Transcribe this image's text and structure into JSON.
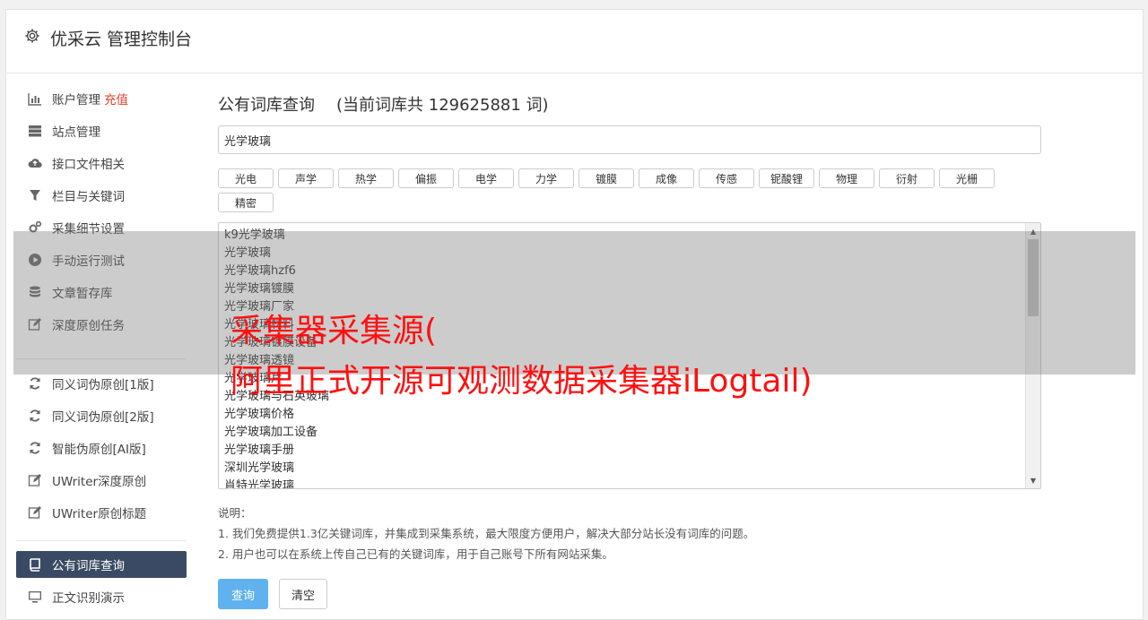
{
  "header": {
    "title": "优采云 管理控制台"
  },
  "sidebar": {
    "items": [
      {
        "label": "账户管理",
        "icon": "bar-chart-icon",
        "badge": "充值"
      },
      {
        "label": "站点管理",
        "icon": "server-icon"
      },
      {
        "label": "接口文件相关",
        "icon": "cloud-upload-icon"
      },
      {
        "label": "栏目与关键词",
        "icon": "filter-icon"
      },
      {
        "label": "采集细节设置",
        "icon": "gears-icon"
      },
      {
        "label": "手动运行测试",
        "icon": "play-circle-icon"
      },
      {
        "label": "文章暂存库",
        "icon": "database-icon"
      },
      {
        "label": "深度原创任务",
        "icon": "edit-icon"
      },
      {
        "label": "同义词伪原创[1版]",
        "icon": "refresh-icon"
      },
      {
        "label": "同义词伪原创[2版]",
        "icon": "refresh-icon"
      },
      {
        "label": "智能伪原创[AI版]",
        "icon": "refresh-icon"
      },
      {
        "label": "UWriter深度原创",
        "icon": "edit-icon"
      },
      {
        "label": "UWriter原创标题",
        "icon": "edit-icon"
      },
      {
        "label": "公有词库查询",
        "icon": "book-icon"
      },
      {
        "label": "正文识别演示",
        "icon": "monitor-icon"
      }
    ]
  },
  "content": {
    "title": "公有词库查询",
    "count_text": "(当前词库共 129625881 词)",
    "search_value": "光学玻璃",
    "tags": [
      "光电",
      "声学",
      "热学",
      "偏振",
      "电学",
      "力学",
      "镀膜",
      "成像",
      "传感",
      "铌酸锂",
      "物理",
      "衍射",
      "光栅",
      "精密"
    ],
    "results": [
      "k9光学玻璃",
      "光学玻璃",
      "光学玻璃hzf6",
      "光学玻璃镀膜",
      "光学玻璃厂家",
      "光学玻璃材料",
      "光学玻璃镀膜设备",
      "光学玻璃透镜",
      "光学玻璃片",
      "光学玻璃与石英玻璃",
      "光学玻璃价格",
      "光学玻璃加工设备",
      "光学玻璃手册",
      "深圳光学玻璃",
      "肖特光学玻璃"
    ],
    "notes": {
      "heading": "说明：",
      "lines": [
        "1. 我们免费提供1.3亿关键词库，并集成到采集系统，最大限度方便用户，解决大部分站长没有词库的问题。",
        "2. 用户也可以在系统上传自己已有的关键词库，用于自己账号下所有网站采集。"
      ]
    },
    "buttons": {
      "query": "查询",
      "clear": "清空"
    }
  },
  "overlay": {
    "line1": "采集器采集源(",
    "line2": "阿里正式开源可观测数据采集器iLogtail)"
  },
  "colors": {
    "accent": "#5fb2ee",
    "active_nav": "#3a4a64",
    "overlay_text": "#ff1010",
    "recharge": "#e23b2e"
  }
}
